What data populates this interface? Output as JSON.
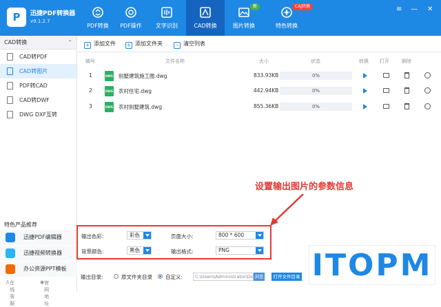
{
  "app": {
    "title": "迅捷PDF转换器",
    "version": "v9.1.2.7",
    "logo": "P"
  },
  "nav": [
    {
      "label": "PDF转换",
      "icon": "refresh-icon"
    },
    {
      "label": "PDF操作",
      "icon": "pdf-operations-icon"
    },
    {
      "label": "文字识别",
      "icon": "ocr-icon"
    },
    {
      "label": "CAD转换",
      "icon": "cad-icon",
      "active": true
    },
    {
      "label": "图片转换",
      "icon": "image-icon"
    },
    {
      "label": "特色转换",
      "icon": "special-convert-icon"
    }
  ],
  "badges": {
    "new": "新",
    "ca": "CAJ转换"
  },
  "window_controls": {
    "menu": "≡",
    "minimize": "—",
    "close": "✕"
  },
  "sidebar": {
    "header": "CAD转换",
    "items": [
      {
        "label": "CAD转PDF"
      },
      {
        "label": "CAD转图片",
        "active": true
      },
      {
        "label": "PDF转CAD"
      },
      {
        "label": "CAD转DWF"
      },
      {
        "label": "DWG DXF互转"
      }
    ],
    "featured_title": "特色产品推荐",
    "featured": [
      {
        "label": "迅捷PDF编辑器",
        "color": "#1e88e5"
      },
      {
        "label": "迅捷视频转换器",
        "color": "#29b6f6"
      },
      {
        "label": "办公资源PPT模板",
        "color": "#ef6c00"
      }
    ],
    "footer": {
      "online_service": "在线客服",
      "website": "官网地址"
    }
  },
  "toolbar": {
    "add_file": "添加文件",
    "add_folder": "添加文件夹",
    "clear_list": "清空列表"
  },
  "table": {
    "headers": {
      "index": "编号",
      "name": "文件名称",
      "size": "大小",
      "status": "状态",
      "convert": "转换",
      "open": "打开",
      "delete": "删除"
    },
    "rows": [
      {
        "index": "1",
        "name": "别墅建筑施工图.dwg",
        "size": "833.93KB",
        "progress": "0%"
      },
      {
        "index": "2",
        "name": "农村住宅.dwg",
        "size": "442.94KB",
        "progress": "0%"
      },
      {
        "index": "3",
        "name": "农村别墅建筑.dwg",
        "size": "855.36KB",
        "progress": "0%"
      }
    ],
    "file_icon_text": "DWG"
  },
  "annotation": "设置输出图片的参数信息",
  "settings": {
    "color_label": "输出色彩:",
    "color_value": "彩色",
    "page_size_label": "页面大小:",
    "page_size_value": "800 * 600",
    "bg_label": "背景颜色:",
    "bg_value": "黑色",
    "format_label": "输出格式:",
    "format_value": "PNG"
  },
  "output": {
    "label": "输出目录:",
    "option_source": "原文件夹目录",
    "option_custom": "自定义:",
    "path": "C:\\Users\\Administrator\\Desktop",
    "browse": "浏览",
    "open_folder": "打开文件目录"
  },
  "watermark": {
    "text": "ITOPM"
  }
}
